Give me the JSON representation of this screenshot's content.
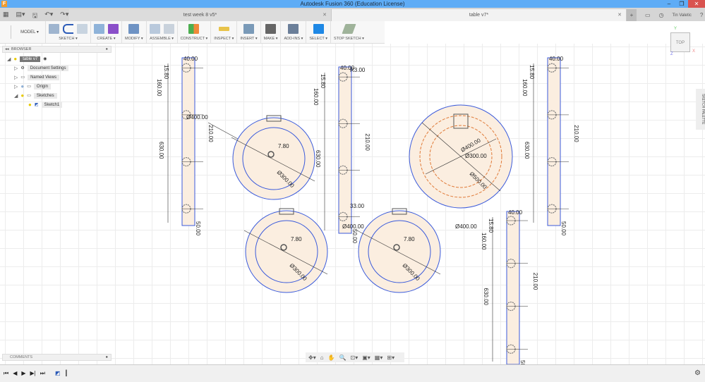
{
  "window": {
    "title": "Autodesk Fusion 360 (Education License)",
    "app_icon": "F"
  },
  "tabs": [
    {
      "label": "test week 8 v5*"
    },
    {
      "label": "table v7*",
      "active": true
    }
  ],
  "user": "Tin Valetic",
  "toolbar": {
    "workspace": "MODEL ▾",
    "groups": [
      "SKETCH ▾",
      "CREATE ▾",
      "MODIFY ▾",
      "ASSEMBLE ▾",
      "CONSTRUCT ▾",
      "INSPECT ▾",
      "INSERT ▾",
      "MAKE ▾",
      "ADD-INS ▾",
      "SELECT ▾",
      "STOP SKETCH ▾"
    ]
  },
  "browser": {
    "title": "BROWSER",
    "items": [
      {
        "label": "table v7"
      },
      {
        "label": "Document Settings"
      },
      {
        "label": "Named Views"
      },
      {
        "label": "Origin"
      },
      {
        "label": "Sketches"
      },
      {
        "label": "Sketch1"
      }
    ]
  },
  "comments": {
    "title": "COMMENTS"
  },
  "viewcube": {
    "face": "TOP",
    "x": "X",
    "y": "Y",
    "z": "Z"
  },
  "sketch_palette": "SKETCH PALETTE",
  "dims": {
    "panel": {
      "w": "40.00",
      "top": "15.80",
      "upper": "160.00",
      "total": "630.00",
      "mid": "210.00",
      "bot": "50.00"
    },
    "r": "R3.00",
    "small": "33.00",
    "d400": "Ø400.00",
    "d300": "Ø300.00",
    "d500": "Ø500.00",
    "off": "7.80"
  },
  "colors": {
    "sketch_fill": "#fbeee0",
    "line_blue": "#3b5bdb",
    "line_orange": "#e07b39",
    "titlebar": "#5eacf6"
  }
}
